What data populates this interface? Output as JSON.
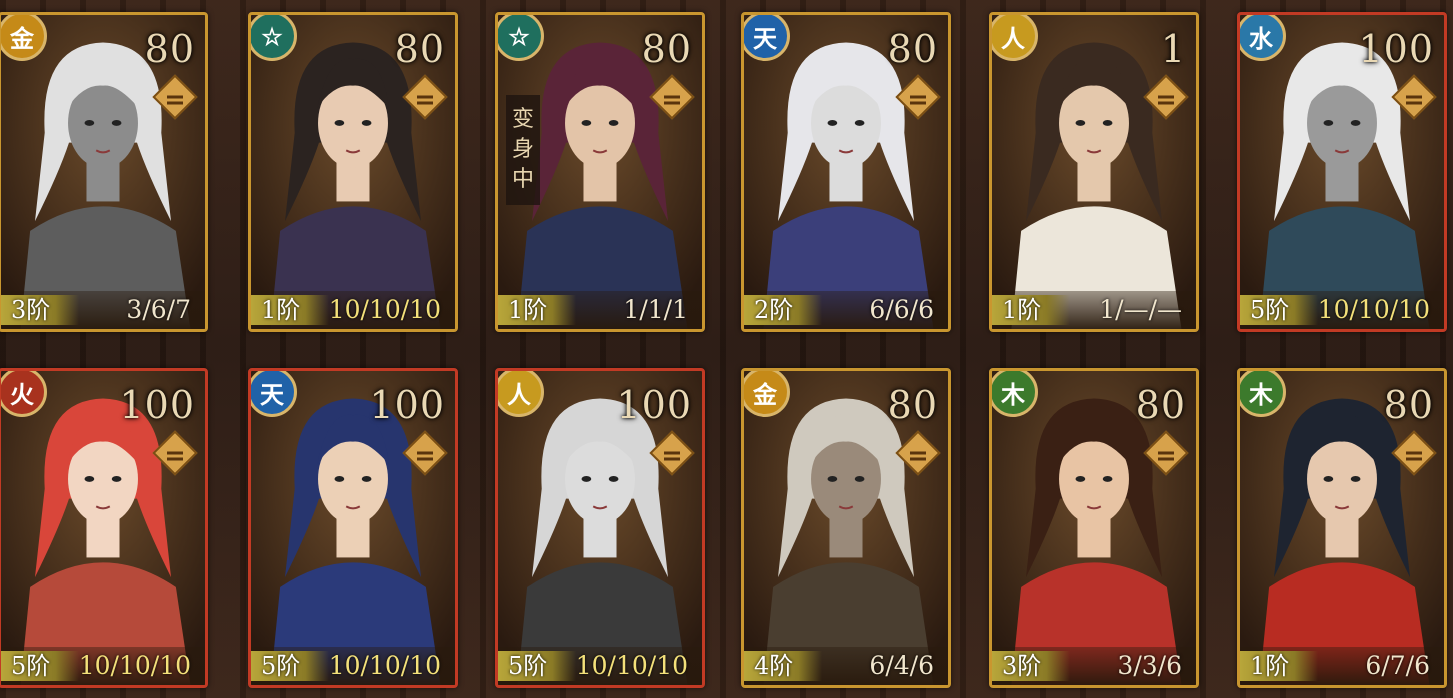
{
  "cards": [
    {
      "element": "金",
      "element_color": "#c58a18",
      "cost": "80",
      "rank": "3阶",
      "stats": "3/6/7",
      "border": "gold",
      "skin": "#8c8c8c",
      "hair": "#e0e0e0",
      "cloth": "#5d5d5d",
      "transform": ""
    },
    {
      "element": "☆",
      "element_color": "#1f6f5e",
      "cost": "80",
      "rank": "1阶",
      "stats": "10/10/10",
      "border": "gold",
      "skin": "#e8cbb2",
      "hair": "#2b2320",
      "cloth": "#3a3250",
      "transform": ""
    },
    {
      "element": "☆",
      "element_color": "#1f6f5e",
      "cost": "80",
      "rank": "1阶",
      "stats": "1/1/1",
      "border": "gold",
      "skin": "#e3c4a8",
      "hair": "#5a2438",
      "cloth": "#2a3356",
      "transform": "变身中"
    },
    {
      "element": "天",
      "element_color": "#2062a8",
      "cost": "80",
      "rank": "2阶",
      "stats": "6/6/6",
      "border": "gold",
      "skin": "#dcdcdc",
      "hair": "#e6e6ea",
      "cloth": "#3b3f7a",
      "transform": ""
    },
    {
      "element": "人",
      "element_color": "#c79a1f",
      "cost": "1",
      "rank": "1阶",
      "stats": "1/—/—",
      "border": "gold",
      "skin": "#e4c8ac",
      "hair": "#3a2a20",
      "cloth": "#ece6da",
      "transform": ""
    },
    {
      "element": "水",
      "element_color": "#2a78a8",
      "cost": "100",
      "rank": "5阶",
      "stats": "10/10/10",
      "border": "red",
      "skin": "#9a9a9a",
      "hair": "#e8e8e8",
      "cloth": "#2f4a5a",
      "transform": ""
    },
    {
      "element": "火",
      "element_color": "#a8321e",
      "cost": "100",
      "rank": "5阶",
      "stats": "10/10/10",
      "border": "red",
      "skin": "#f2d6c2",
      "hair": "#d9463a",
      "cloth": "#b64a3a",
      "transform": ""
    },
    {
      "element": "天",
      "element_color": "#2062a8",
      "cost": "100",
      "rank": "5阶",
      "stats": "10/10/10",
      "border": "red",
      "skin": "#ecd0b6",
      "hair": "#27356e",
      "cloth": "#2b3a7a",
      "transform": ""
    },
    {
      "element": "人",
      "element_color": "#c79a1f",
      "cost": "100",
      "rank": "5阶",
      "stats": "10/10/10",
      "border": "red",
      "skin": "#dcdcdc",
      "hair": "#d6d6d6",
      "cloth": "#3a3a3a",
      "transform": ""
    },
    {
      "element": "金",
      "element_color": "#c58a18",
      "cost": "80",
      "rank": "4阶",
      "stats": "6/4/6",
      "border": "gold",
      "skin": "#9a8a7a",
      "hair": "#cfc9be",
      "cloth": "#4a3e30",
      "transform": ""
    },
    {
      "element": "木",
      "element_color": "#3c7a2c",
      "cost": "80",
      "rank": "3阶",
      "stats": "3/3/6",
      "border": "gold",
      "skin": "#e8c4a4",
      "hair": "#3a2014",
      "cloth": "#b8322a",
      "transform": ""
    },
    {
      "element": "木",
      "element_color": "#3c7a2c",
      "cost": "80",
      "rank": "1阶",
      "stats": "6/7/6",
      "border": "gold",
      "skin": "#e6c8ae",
      "hair": "#1e2430",
      "cloth": "#b82c22",
      "transform": ""
    }
  ]
}
